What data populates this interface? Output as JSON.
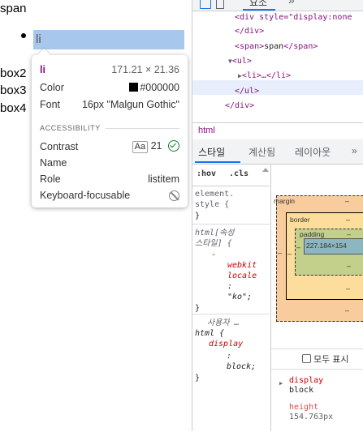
{
  "page": {
    "span_text": "span",
    "li_text": "li",
    "box_items": [
      "box2",
      "box3",
      "box4"
    ]
  },
  "tooltip": {
    "tag": "li",
    "size": "171.21 × 21.36",
    "rows": [
      {
        "label": "Color",
        "value": "#000000"
      },
      {
        "label": "Font",
        "value": "16px \"Malgun Gothic\""
      }
    ],
    "section_title": "ACCESSIBILITY",
    "contrast_label": "Contrast",
    "contrast_badge": "Aa",
    "contrast_value": "21",
    "name_label": "Name",
    "role_label": "Role",
    "role_value": "listitem",
    "keyboard_label": "Keyboard-focusable"
  },
  "devtools": {
    "top_tab": "요소",
    "top_more": "»",
    "dom": {
      "line1": "<div style=\"display:none",
      "line2": "</div>",
      "line3_open": "<span>",
      "line3_text": "span",
      "line3_close": "</span>",
      "line4": "<ul>",
      "line5": "<li>…</li>",
      "line6": "</ul>",
      "line7": "</div>"
    },
    "breadcrumb": "html",
    "tabs": [
      "스타일",
      "계산됨",
      "레이아웃",
      "»"
    ],
    "styles": {
      "hov": ":hov",
      "cls": ".cls",
      "element_selector": "element.",
      "element_style": "style {",
      "close_brace": "}",
      "rule1_selector": "html[속성",
      "rule1_selector2": "스타일] {",
      "rule1_dash": "-",
      "rule1_prop": "webkit",
      "rule1_prop2": "locale",
      "rule1_colon": ":",
      "rule1_value": "\"ko\";",
      "rule2_source": "사용자 …",
      "rule2_selector": "html {",
      "rule2_prop": "display",
      "rule2_colon": ":",
      "rule2_value": "block;"
    },
    "box_model": {
      "margin_label": "margin",
      "border_label": "border",
      "padding_label": "padding",
      "dash": "–",
      "content_size": "227.184×154"
    },
    "show_all_label": "모두 표시",
    "computed": [
      {
        "prop": "display",
        "value": "block"
      },
      {
        "prop": "height",
        "value": "154.763px"
      }
    ]
  }
}
